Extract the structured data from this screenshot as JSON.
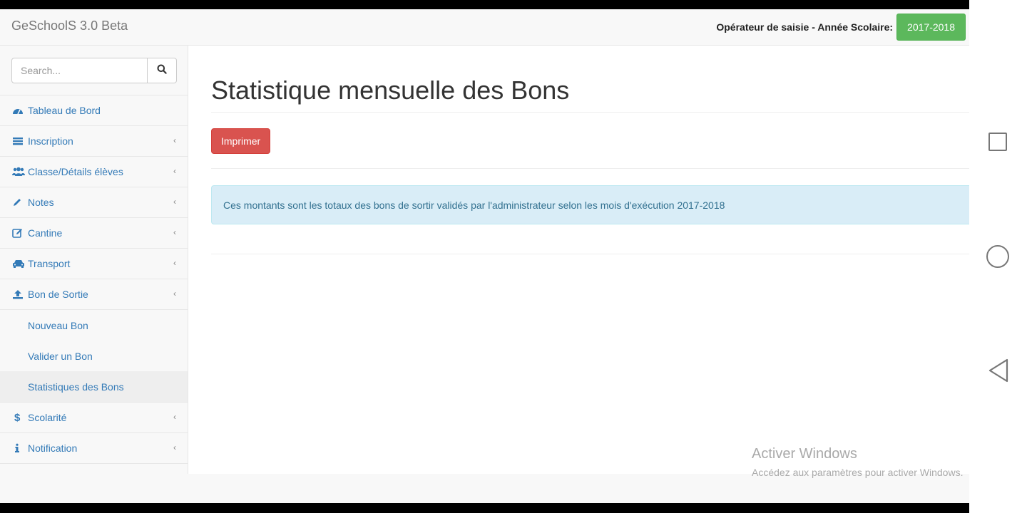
{
  "navbar": {
    "brand": "GeSchoolS 3.0 Beta",
    "operator_label": "Opérateur de saisie - Année Scolaire:",
    "year_button": "2017-2018"
  },
  "search": {
    "placeholder": "Search...",
    "icon": "search-icon"
  },
  "sidebar": {
    "items": [
      {
        "label": "Tableau de Bord",
        "icon": "dashboard-icon",
        "has_children": false
      },
      {
        "label": "Inscription",
        "icon": "list-icon",
        "has_children": true
      },
      {
        "label": "Classe/Détails élèves",
        "icon": "users-icon",
        "has_children": true
      },
      {
        "label": "Notes",
        "icon": "pencil-icon",
        "has_children": true
      },
      {
        "label": "Cantine",
        "icon": "edit-icon",
        "has_children": true
      },
      {
        "label": "Transport",
        "icon": "car-icon",
        "has_children": true
      },
      {
        "label": "Bon de Sortie",
        "icon": "upload-icon",
        "has_children": true,
        "expanded": true
      },
      {
        "label": "Scolarité",
        "icon": "dollar-icon",
        "has_children": true
      },
      {
        "label": "Notification",
        "icon": "info-icon",
        "has_children": true
      }
    ],
    "bon_sortie_children": [
      {
        "label": "Nouveau Bon",
        "active": false
      },
      {
        "label": "Valider un Bon",
        "active": false
      },
      {
        "label": "Statistiques des Bons",
        "active": true
      }
    ],
    "chevron": "‹"
  },
  "main": {
    "title": "Statistique mensuelle des Bons",
    "print_button": "Imprimer",
    "info_text": "Ces montants sont les totaux des bons de sortir validés par l'administrateur selon les mois d'exécution 2017-2018"
  },
  "watermark": {
    "title": "Activer Windows",
    "subtitle": "Accédez aux paramètres pour activer Windows."
  },
  "colors": {
    "year_button": "#5cb85c",
    "print_button": "#d9534f",
    "info_bg": "#d9edf7",
    "link": "#337ab7"
  }
}
